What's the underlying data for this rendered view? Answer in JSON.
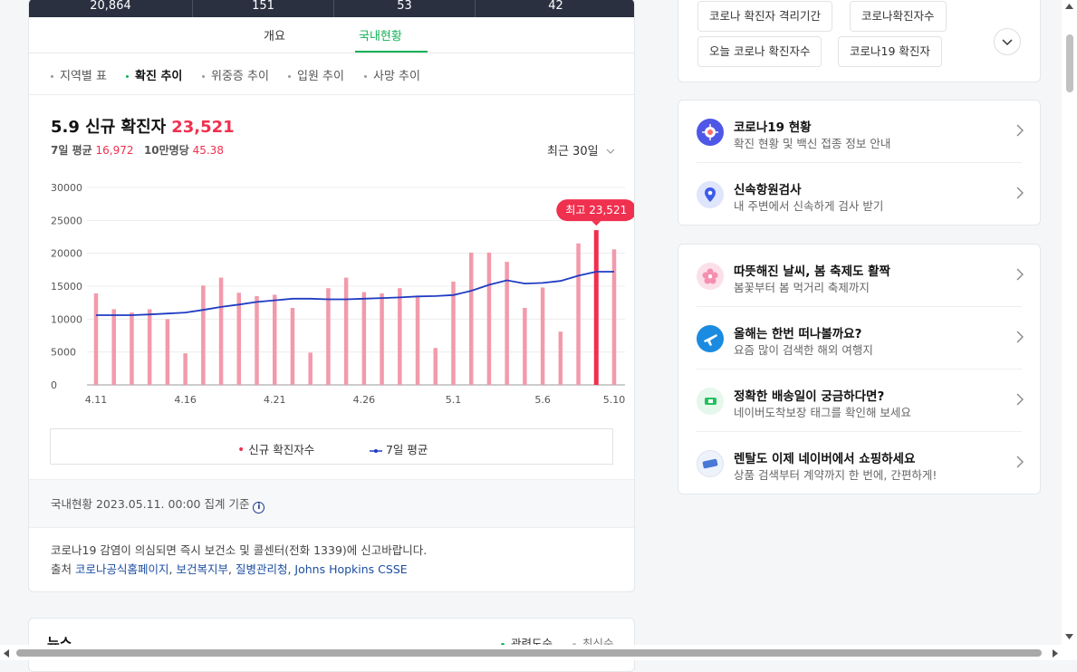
{
  "top_stats": [
    "20,864",
    "151",
    "53",
    "42"
  ],
  "tabs": [
    {
      "label": "개요"
    },
    {
      "label": "국내현황"
    }
  ],
  "subtabs": [
    {
      "label": "지역별 표"
    },
    {
      "label": "확진 추이"
    },
    {
      "label": "위중증 추이"
    },
    {
      "label": "입원 추이"
    },
    {
      "label": "사망 추이"
    }
  ],
  "summary": {
    "title": "5.9 신규 확진자",
    "value": "23,521",
    "avg_label": "7일 평균",
    "avg_value": "16,972",
    "per100k_label": "10만명당",
    "per100k_value": "45.38",
    "range": "최근 30일"
  },
  "chart_data": {
    "type": "bar",
    "yticks": [
      "30000",
      "25000",
      "20000",
      "15000",
      "10000",
      "5000",
      "0"
    ],
    "xticks": [
      "4.11",
      "4.16",
      "4.21",
      "4.26",
      "5.1",
      "5.6",
      "5.10"
    ],
    "ylim": [
      0,
      30000
    ],
    "series": [
      {
        "name": "신규 확진자수",
        "color": "#f29aab",
        "values": [
          13900,
          11500,
          11000,
          11500,
          10000,
          4800,
          15100,
          16300,
          14000,
          13500,
          13700,
          11700,
          4900,
          14700,
          16300,
          14100,
          13900,
          14700,
          13500,
          5600,
          15700,
          20100,
          20100,
          18700,
          11700,
          14800,
          8100,
          21500,
          23521,
          20600
        ]
      },
      {
        "name": "7일 평균",
        "color": "#1f3bc2",
        "values": [
          10600,
          10600,
          10600,
          10700,
          10850,
          11000,
          11400,
          11850,
          12200,
          12600,
          12850,
          13100,
          13100,
          13000,
          13000,
          13100,
          13200,
          13300,
          13450,
          13500,
          13650,
          14300,
          15200,
          15900,
          15400,
          15500,
          15800,
          16600,
          17200,
          17200
        ]
      }
    ],
    "highlight": {
      "index": 28,
      "label": "최고 23,521"
    }
  },
  "legend": [
    {
      "label": "신규 확진자수"
    },
    {
      "label": "7일 평균"
    }
  ],
  "footer": {
    "date": "국내현황 2023.05.11. 00:00 집계 기준",
    "notice": "코로나19 감염이 의심되면 즉시 보건소 및 콜센터(전화 1339)에 신고바랍니다.",
    "source_label": "출처",
    "sources": [
      "코로나공식홈페이지",
      "보건복지부",
      "질병관리청",
      "Johns Hopkins CSSE"
    ]
  },
  "news": {
    "title": "뉴스",
    "sort": [
      "관련도순",
      "최신순"
    ]
  },
  "related": [
    "코로나 확진자 격리기간",
    "코로나확진자수",
    "오늘 코로나 확진자수",
    "코로나19 확진자"
  ],
  "card2": [
    {
      "title": "코로나19 현황",
      "desc": "확진 현황 및 백신 접종 정보 안내",
      "icon": "virus-icon"
    },
    {
      "title": "신속항원검사",
      "desc": "내 주변에서 신속하게 검사 받기",
      "icon": "location-pin-icon"
    }
  ],
  "card3": [
    {
      "title": "따뜻해진 날씨, 봄 축제도 활짝",
      "desc": "봄꽃부터 봄 먹거리 축제까지",
      "icon": "blossom-icon"
    },
    {
      "title": "올해는 한번 떠나볼까요?",
      "desc": "요즘 많이 검색한 해외 여행지",
      "icon": "airplane-icon"
    },
    {
      "title": "정확한 배송일이 궁금하다면?",
      "desc": "네이버도착보장 태그를 확인해 보세요",
      "icon": "delivery-icon"
    },
    {
      "title": "렌탈도 이제 네이버에서 쇼핑하세요",
      "desc": "상품 검색부터 계약까지 한 번에, 간편하게!",
      "icon": "rental-icon"
    }
  ]
}
